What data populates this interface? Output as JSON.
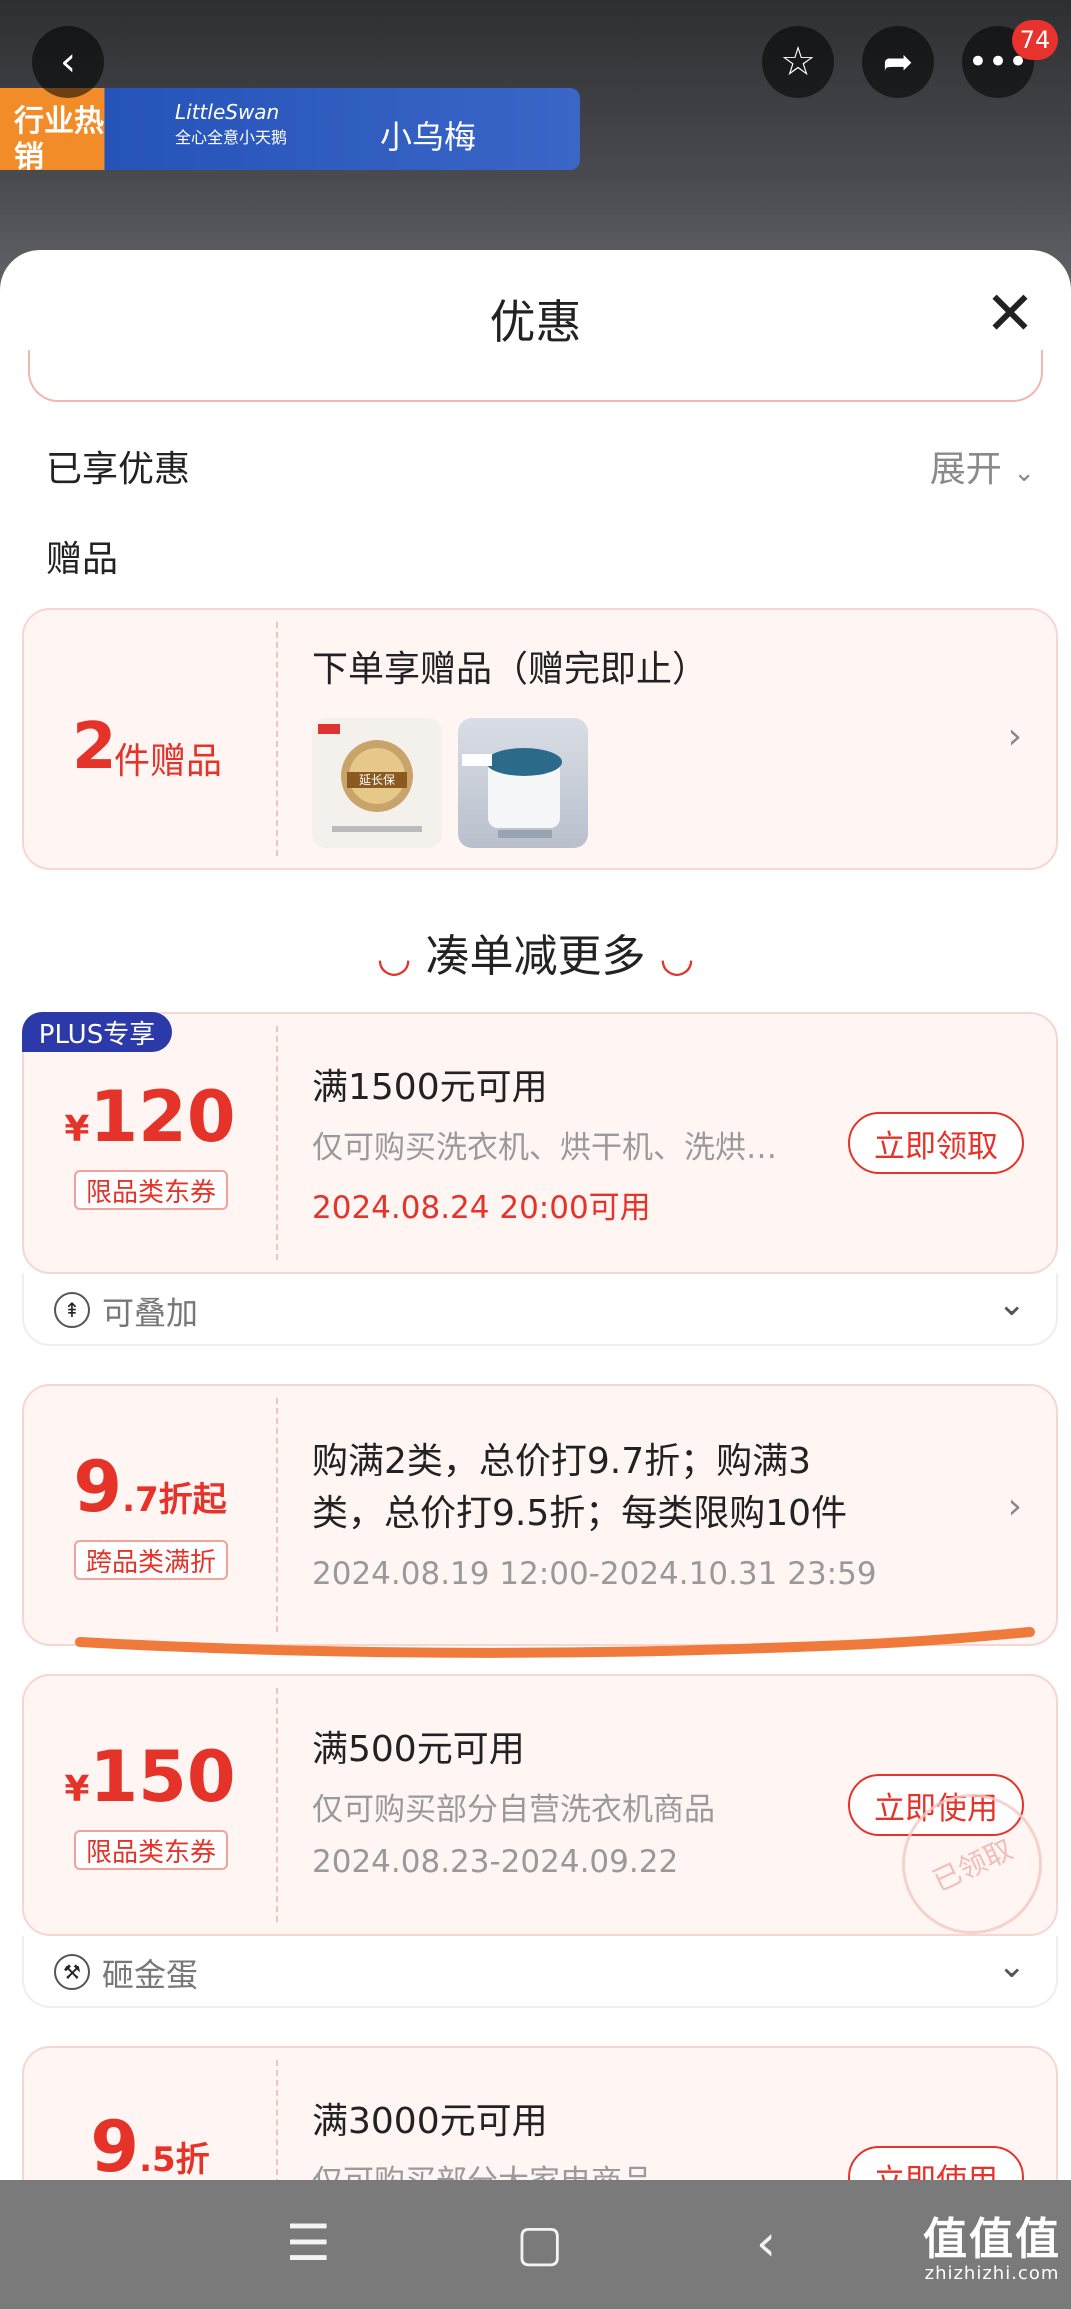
{
  "top": {
    "notification_count": "74",
    "hot_badge": "行业热销",
    "brand1": "LittleSwan",
    "brand1_sub": "全心全意小天鹅",
    "brand2": "小乌梅"
  },
  "sheet": {
    "title": "优惠",
    "enjoyed_label": "已享优惠",
    "expand_label": "展开",
    "gift_section_label": "赠品",
    "more_heading": "凑单减更多"
  },
  "gift_card": {
    "count": "2",
    "unit": "件赠品",
    "title": "下单享赠品（赠完即止）",
    "images": [
      "延长保",
      "小天鹅洗衣机"
    ]
  },
  "coupons": [
    {
      "badge": "PLUS专享",
      "currency": "¥",
      "amount": "120",
      "tag": "限品类东券",
      "title": "满1500元可用",
      "desc": "仅可购买洗衣机、烘干机、洗烘…",
      "date": "2024.08.24 20:00可用",
      "button": "立即领取",
      "footer": "可叠加"
    },
    {
      "amount_big": "9",
      "amount_small": ".7折起",
      "tag": "跨品类满折",
      "title": "购满2类，总价打9.7折；购满3类，总价打9.5折；每类限购10件",
      "title_line1": "购满2类，总价打9.7折；购满3",
      "title_line2": "类，总价打9.5折；每类限购10件",
      "date": "2024.08.19 12:00-2024.10.31 23:59"
    },
    {
      "currency": "¥",
      "amount": "150",
      "tag": "限品类东券",
      "title": "满500元可用",
      "desc": "仅可购买部分自营洗衣机商品",
      "date": "2024.08.23-2024.09.22",
      "button": "立即使用",
      "stamp": "已领取",
      "footer": "砸金蛋"
    },
    {
      "amount_big": "9",
      "amount_small": ".5折",
      "title": "满3000元可用",
      "desc": "仅可购买部分大家电商品",
      "button": "立即使用"
    }
  ],
  "watermark": {
    "text": "值值值",
    "sub": "zhizhizhi.com"
  },
  "colors": {
    "accent": "#e5332a",
    "card_bg": "#fff6f4",
    "plus_badge": "#2b3aa8",
    "underline": "#f07a3c"
  }
}
